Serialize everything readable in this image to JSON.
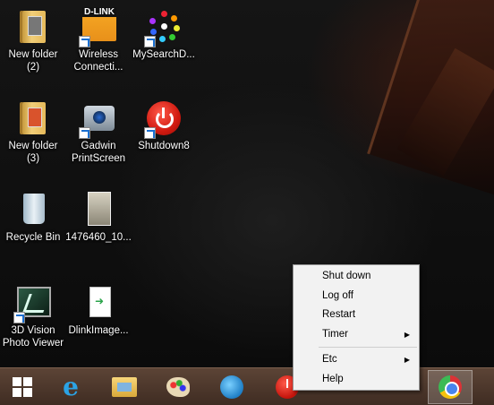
{
  "desktop_icons": [
    {
      "label": "New folder\n(2)",
      "icon": "folder-icon"
    },
    {
      "label": "Wireless\nConnecti...",
      "icon": "dlink-icon",
      "brand_text": "D-LINK"
    },
    {
      "label": "MySearchD...",
      "icon": "mysearch-dots-icon"
    },
    {
      "label": "New folder\n(3)",
      "icon": "folder-icon"
    },
    {
      "label": "Gadwin\nPrintScreen",
      "icon": "camera-icon"
    },
    {
      "label": "Shutdown8",
      "icon": "power-icon"
    },
    {
      "label": "Recycle Bin",
      "icon": "recycle-bin-icon"
    },
    {
      "label": "1476460_10...",
      "icon": "photo-icon"
    },
    {
      "label": "3D Vision\nPhoto Viewer",
      "icon": "3d-vision-icon"
    },
    {
      "label": "DlinkImage...",
      "icon": "file-icon"
    }
  ],
  "taskbar": {
    "items": [
      {
        "name": "start-button",
        "icon": "windows-logo-icon"
      },
      {
        "name": "internet-explorer",
        "icon": "ie-icon",
        "glyph": "e"
      },
      {
        "name": "file-explorer",
        "icon": "folder-icon"
      },
      {
        "name": "paint",
        "icon": "palette-icon"
      },
      {
        "name": "app",
        "icon": "bird-icon"
      },
      {
        "name": "shutdown8",
        "icon": "power-icon"
      },
      {
        "name": "chrome",
        "icon": "chrome-icon"
      }
    ]
  },
  "context_menu": {
    "items": [
      {
        "label": "Shut down",
        "submenu": false
      },
      {
        "label": "Log off",
        "submenu": false
      },
      {
        "label": "Restart",
        "submenu": false
      },
      {
        "label": "Timer",
        "submenu": true
      },
      {
        "label": "Etc",
        "submenu": true
      },
      {
        "label": "Help",
        "submenu": false
      }
    ],
    "submenu_arrow": "▶"
  },
  "colors": {
    "taskbar": "#4a3528",
    "menu_bg": "#f2f2f2",
    "power_red": "#d11a10",
    "dlink_orange": "#f5a623"
  }
}
